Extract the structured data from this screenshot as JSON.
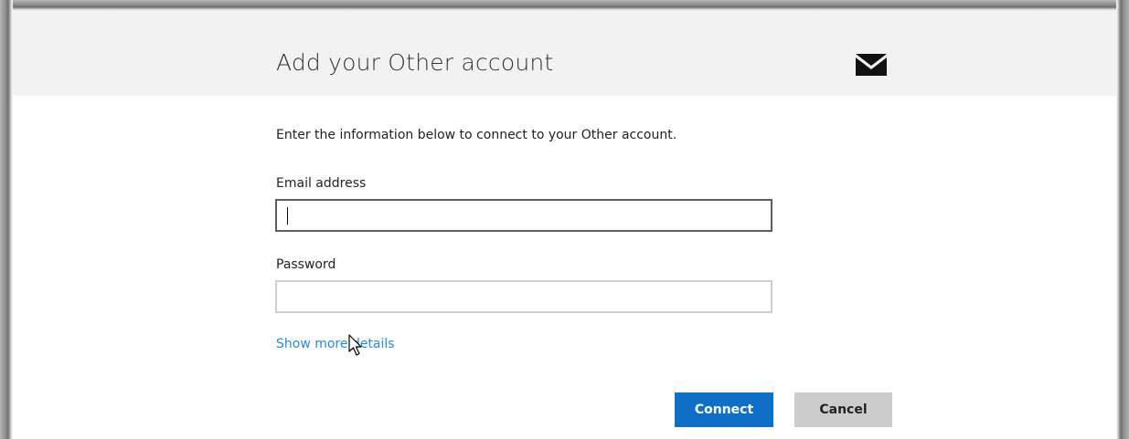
{
  "dialog": {
    "title": "Add your Other account",
    "title_icon": "mail-envelope-icon",
    "intro_text": "Enter the information below to connect to your Other account.",
    "email": {
      "label": "Email address",
      "value": "",
      "placeholder": ""
    },
    "password": {
      "label": "Password",
      "value": "",
      "placeholder": ""
    },
    "show_more_link": "Show more details",
    "buttons": {
      "connect_label": "Connect",
      "cancel_label": "Cancel"
    }
  },
  "colors": {
    "header_background": "#f2f2f2",
    "link": "#2b88d8",
    "connect_button": "#0f6fc6",
    "cancel_button": "#cccccc",
    "text": "#222222"
  }
}
